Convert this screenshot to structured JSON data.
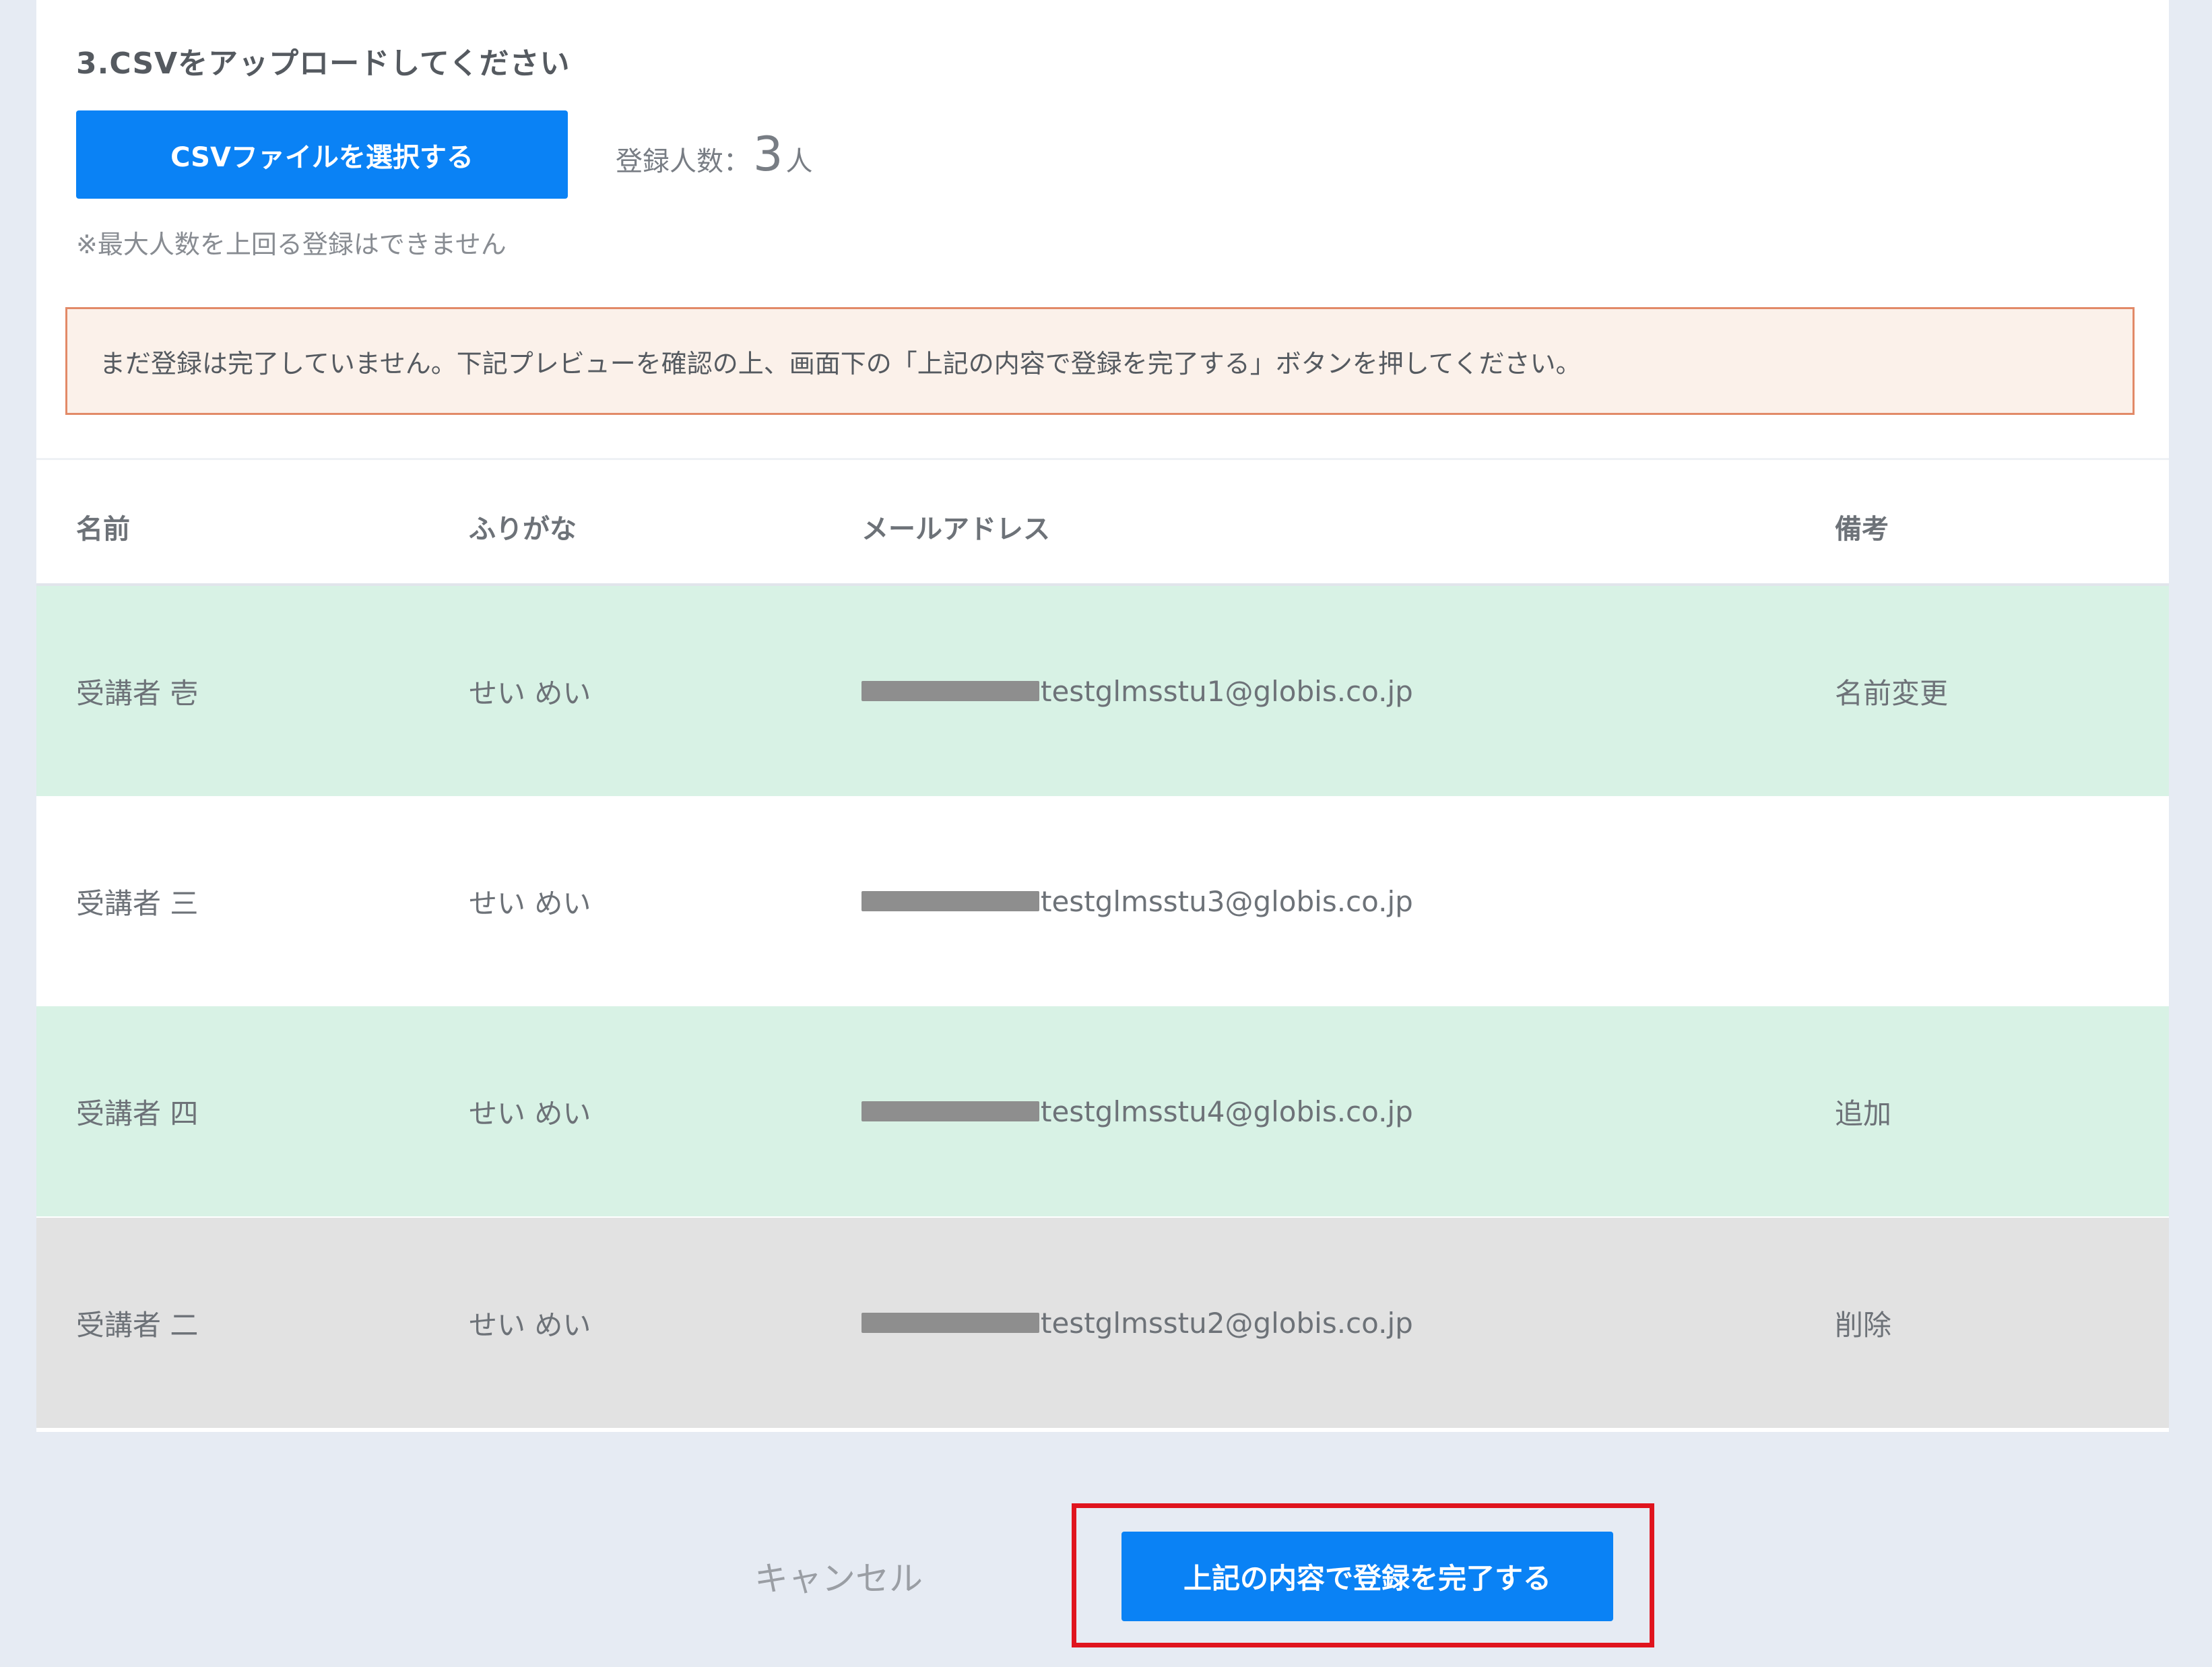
{
  "upload": {
    "heading": "3.CSVをアップロードしてください",
    "select_button_label": "CSVファイルを選択する",
    "count_label": "登録人数：",
    "count_value": "3",
    "count_unit": "人",
    "note": "※最大人数を上回る登録はできません"
  },
  "alert": {
    "message": "まだ登録は完了していません。下記プレビューを確認の上、画面下の「上記の内容で登録を完了する」ボタンを押してください。"
  },
  "table": {
    "headers": {
      "name": "名前",
      "kana": "ふりがな",
      "email": "メールアドレス",
      "note": "備考"
    },
    "rows": [
      {
        "name": "受講者 壱",
        "kana": "せい めい",
        "email": "testglmsstu1@globis.co.jp",
        "note": "名前変更",
        "status": "changed"
      },
      {
        "name": "受講者 三",
        "kana": "せい めい",
        "email": "testglmsstu3@globis.co.jp",
        "note": "",
        "status": "unchanged"
      },
      {
        "name": "受講者 四",
        "kana": "せい めい",
        "email": "testglmsstu4@globis.co.jp",
        "note": "追加",
        "status": "added"
      },
      {
        "name": "受講者 二",
        "kana": "せい めい",
        "email": "testglmsstu2@globis.co.jp",
        "note": "削除",
        "status": "deleted"
      }
    ]
  },
  "footer": {
    "cancel_label": "キャンセル",
    "complete_label": "上記の内容で登録を完了する"
  },
  "colors": {
    "primary": "#0a82f5",
    "added_row": "#d8f2e5",
    "deleted_row": "#e2e2e2",
    "alert_border": "#e28a68",
    "alert_bg": "#fbf1ea",
    "highlight": "#e0141e"
  }
}
